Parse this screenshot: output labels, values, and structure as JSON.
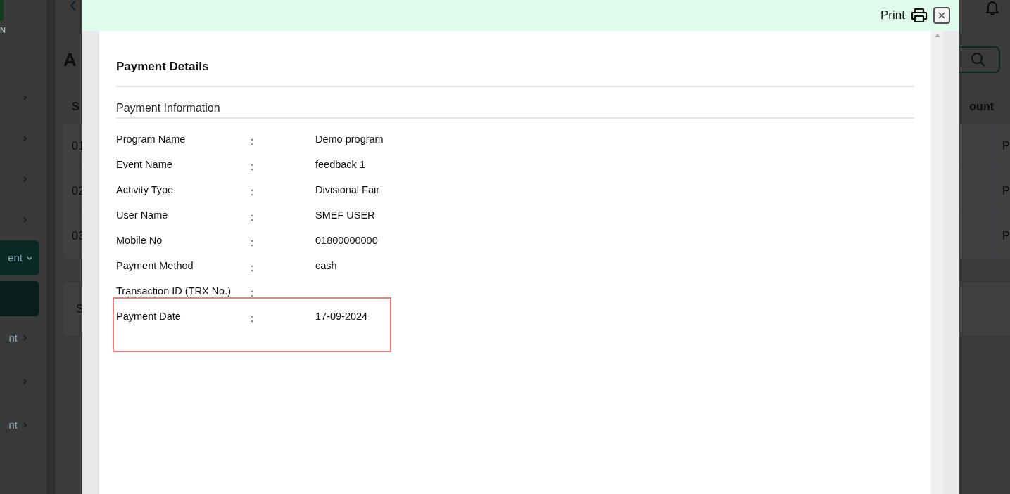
{
  "background_page": {
    "logo_text": "N",
    "sidebar_items": [
      {
        "kind": "link"
      },
      {
        "kind": "link"
      },
      {
        "kind": "link"
      },
      {
        "kind": "link"
      },
      {
        "kind": "group",
        "label": "ent",
        "expanded": true
      },
      {
        "kind": "active"
      },
      {
        "kind": "link",
        "label": "nt"
      },
      {
        "kind": "link"
      },
      {
        "kind": "link",
        "label": "nt"
      }
    ],
    "heading": "A",
    "table": {
      "columns": [
        "S",
        "ount"
      ],
      "rows": [
        {
          "column_1": "01",
          "column_3": "P"
        },
        {
          "column_1": "02",
          "column_3": "P"
        },
        {
          "column_1": "03",
          "column_3": "P"
        }
      ]
    },
    "footer_text": "S"
  },
  "modal": {
    "print_label": "Print",
    "title": "Payment Details",
    "section": "Payment Information",
    "rows": [
      {
        "label": "Program Name",
        "separator": ":",
        "value": "Demo program",
        "highlighted": false
      },
      {
        "label": "Event Name",
        "separator": ":",
        "value": "feedback 1",
        "highlighted": false
      },
      {
        "label": "Activity Type",
        "separator": ":",
        "value": "Divisional Fair",
        "highlighted": false
      },
      {
        "label": "User Name",
        "separator": ":",
        "value": "SMEF USER",
        "highlighted": false
      },
      {
        "label": "Mobile No",
        "separator": ":",
        "value": "01800000000",
        "highlighted": false
      },
      {
        "label": "Payment Method",
        "separator": ":",
        "value": "cash",
        "highlighted": false
      },
      {
        "label": "Transaction ID (TRX No.)",
        "separator": ":",
        "highlighted": false
      },
      {
        "label": "Payment Date",
        "separator": ":",
        "value": "17-09-2024",
        "highlighted": true
      }
    ]
  }
}
